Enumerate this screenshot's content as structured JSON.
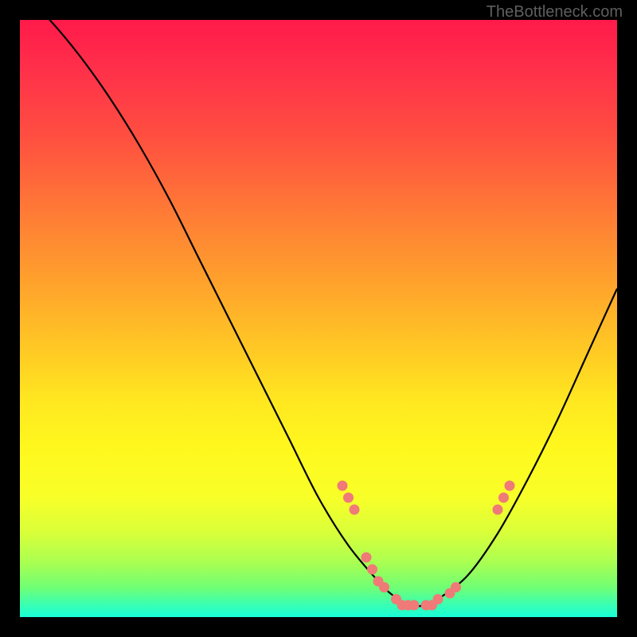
{
  "watermark": "TheBottleneck.com",
  "chart_data": {
    "type": "line",
    "title": "",
    "xlabel": "",
    "ylabel": "",
    "xlim": [
      0,
      100
    ],
    "ylim": [
      0,
      100
    ],
    "series": [
      {
        "name": "bottleneck-curve",
        "x": [
          0,
          5,
          10,
          15,
          20,
          25,
          30,
          35,
          40,
          45,
          50,
          55,
          60,
          62,
          65,
          68,
          70,
          75,
          80,
          85,
          90,
          95,
          100
        ],
        "values": [
          105,
          100,
          94,
          87,
          79,
          70,
          60,
          50,
          40,
          30,
          20,
          12,
          6,
          4,
          2,
          2,
          3,
          7,
          14,
          23,
          33,
          44,
          55
        ]
      }
    ],
    "scatter_points": {
      "name": "highlight-dots",
      "color": "#ef7a78",
      "points": [
        {
          "x": 54,
          "y": 22
        },
        {
          "x": 55,
          "y": 20
        },
        {
          "x": 56,
          "y": 18
        },
        {
          "x": 58,
          "y": 10
        },
        {
          "x": 59,
          "y": 8
        },
        {
          "x": 60,
          "y": 6
        },
        {
          "x": 61,
          "y": 5
        },
        {
          "x": 63,
          "y": 3
        },
        {
          "x": 64,
          "y": 2
        },
        {
          "x": 65,
          "y": 2
        },
        {
          "x": 66,
          "y": 2
        },
        {
          "x": 68,
          "y": 2
        },
        {
          "x": 69,
          "y": 2
        },
        {
          "x": 70,
          "y": 3
        },
        {
          "x": 72,
          "y": 4
        },
        {
          "x": 73,
          "y": 5
        },
        {
          "x": 80,
          "y": 18
        },
        {
          "x": 81,
          "y": 20
        },
        {
          "x": 82,
          "y": 22
        }
      ]
    }
  }
}
